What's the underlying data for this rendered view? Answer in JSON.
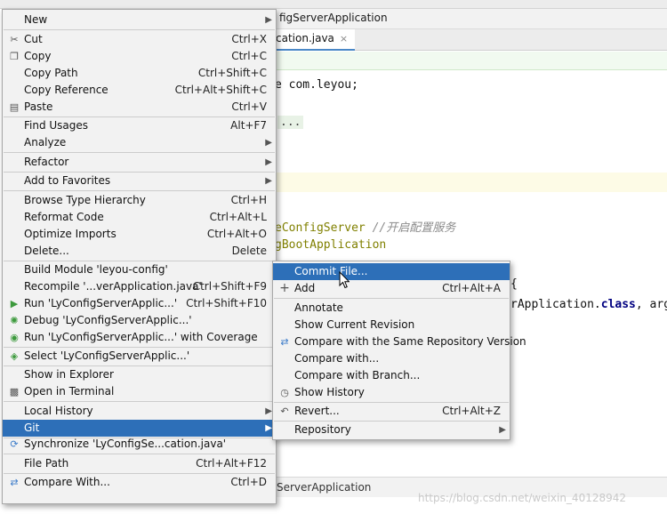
{
  "editor": {
    "breadcrumb": "figServerApplication",
    "tab_label": "cation.java",
    "tab_close": "×",
    "code": {
      "package": "e com.leyou;",
      "fold": "...",
      "annotation1": "eConfigServer",
      "annotation1_comment": "//开启配置服务",
      "annotation2": "gBootApplication",
      "fragment1": "{",
      "run_prefix": "rApplication.",
      "run_keyword": "class",
      "run_suffix": ", args)"
    },
    "bottom_bar": "ServerApplication",
    "watermark": "https://blog.csdn.net/weixin_40128942"
  },
  "context_menu": {
    "items": [
      {
        "label": "New",
        "icon": "",
        "shortcut": "",
        "submenu": true
      },
      {
        "label": "Cut",
        "icon": "scissors-icon",
        "shortcut": "Ctrl+X"
      },
      {
        "label": "Copy",
        "icon": "copy-icon",
        "shortcut": "Ctrl+C"
      },
      {
        "label": "Copy Path",
        "icon": "",
        "shortcut": "Ctrl+Shift+C"
      },
      {
        "label": "Copy Reference",
        "icon": "",
        "shortcut": "Ctrl+Alt+Shift+C"
      },
      {
        "label": "Paste",
        "icon": "paste-icon",
        "shortcut": "Ctrl+V"
      },
      {
        "label": "Find Usages",
        "icon": "",
        "shortcut": "Alt+F7"
      },
      {
        "label": "Analyze",
        "icon": "",
        "shortcut": "",
        "submenu": true
      },
      {
        "label": "Refactor",
        "icon": "",
        "shortcut": "",
        "submenu": true
      },
      {
        "label": "Add to Favorites",
        "icon": "",
        "shortcut": "",
        "submenu": true
      },
      {
        "label": "Browse Type Hierarchy",
        "icon": "",
        "shortcut": "Ctrl+H"
      },
      {
        "label": "Reformat Code",
        "icon": "",
        "shortcut": "Ctrl+Alt+L"
      },
      {
        "label": "Optimize Imports",
        "icon": "",
        "shortcut": "Ctrl+Alt+O"
      },
      {
        "label": "Delete...",
        "icon": "",
        "shortcut": "Delete"
      },
      {
        "label": "Build Module 'leyou-config'",
        "icon": "",
        "shortcut": ""
      },
      {
        "label": "Recompile '...verApplication.java'",
        "icon": "",
        "shortcut": "Ctrl+Shift+F9"
      },
      {
        "label": "Run 'LyConfigServerApplic...'",
        "icon": "run-icon",
        "shortcut": "Ctrl+Shift+F10"
      },
      {
        "label": "Debug 'LyConfigServerApplic...'",
        "icon": "debug-icon",
        "shortcut": ""
      },
      {
        "label": "Run 'LyConfigServerApplic...' with Coverage",
        "icon": "coverage-icon",
        "shortcut": ""
      },
      {
        "label": "Select 'LyConfigServerApplic...'",
        "icon": "select-config-icon",
        "shortcut": ""
      },
      {
        "label": "Show in Explorer",
        "icon": "",
        "shortcut": ""
      },
      {
        "label": "Open in Terminal",
        "icon": "terminal-icon",
        "shortcut": ""
      },
      {
        "label": "Local History",
        "icon": "",
        "shortcut": "",
        "submenu": true
      },
      {
        "label": "Git",
        "icon": "",
        "shortcut": "",
        "submenu": true
      },
      {
        "label": "Synchronize 'LyConfigSe...cation.java'",
        "icon": "sync-icon",
        "shortcut": ""
      },
      {
        "label": "File Path",
        "icon": "",
        "shortcut": "Ctrl+Alt+F12"
      },
      {
        "label": "Compare With...",
        "icon": "compare-icon",
        "shortcut": "Ctrl+D"
      }
    ]
  },
  "git_menu": {
    "items": [
      {
        "label": "Commit File...",
        "icon": "",
        "shortcut": ""
      },
      {
        "label": "Add",
        "icon": "plus-icon",
        "shortcut": "Ctrl+Alt+A"
      },
      {
        "label": "Annotate",
        "icon": "",
        "shortcut": ""
      },
      {
        "label": "Show Current Revision",
        "icon": "",
        "shortcut": ""
      },
      {
        "label": "Compare with the Same Repository Version",
        "icon": "compare-icon",
        "shortcut": ""
      },
      {
        "label": "Compare with...",
        "icon": "",
        "shortcut": ""
      },
      {
        "label": "Compare with Branch...",
        "icon": "",
        "shortcut": ""
      },
      {
        "label": "Show History",
        "icon": "clock-icon",
        "shortcut": ""
      },
      {
        "label": "Revert...",
        "icon": "revert-icon",
        "shortcut": "Ctrl+Alt+Z"
      },
      {
        "label": "Repository",
        "icon": "",
        "shortcut": "",
        "submenu": true
      }
    ]
  },
  "colors": {
    "selection": "#2d6fb8",
    "menu_bg": "#f2f2f2"
  }
}
